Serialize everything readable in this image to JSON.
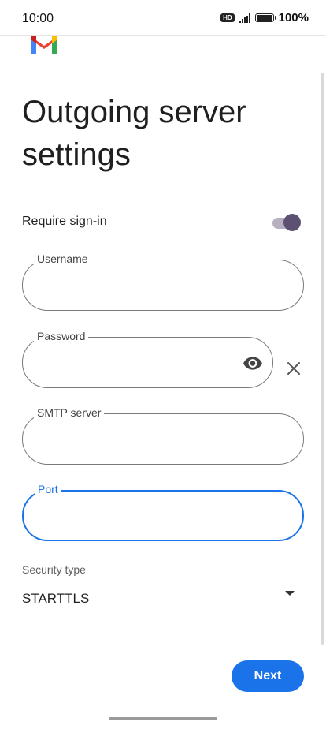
{
  "status_bar": {
    "time": "10:00",
    "hd_badge": "HD",
    "battery_percent": "100%"
  },
  "header": {
    "title": "Outgoing server settings"
  },
  "require_signin": {
    "label": "Require sign-in",
    "enabled": true
  },
  "fields": {
    "username": {
      "label": "Username",
      "value": ""
    },
    "password": {
      "label": "Password",
      "value": ""
    },
    "smtp_server": {
      "label": "SMTP server",
      "value": ""
    },
    "port": {
      "label": "Port",
      "value": ""
    }
  },
  "security": {
    "label": "Security type",
    "value": "STARTTLS"
  },
  "actions": {
    "next_label": "Next"
  },
  "colors": {
    "accent": "#1a73e8",
    "toggle_thumb": "#5d5171",
    "toggle_track": "#b7b0c3"
  },
  "icons": [
    "gmail-logo",
    "eye-icon",
    "close-icon",
    "dropdown-arrow-icon"
  ]
}
